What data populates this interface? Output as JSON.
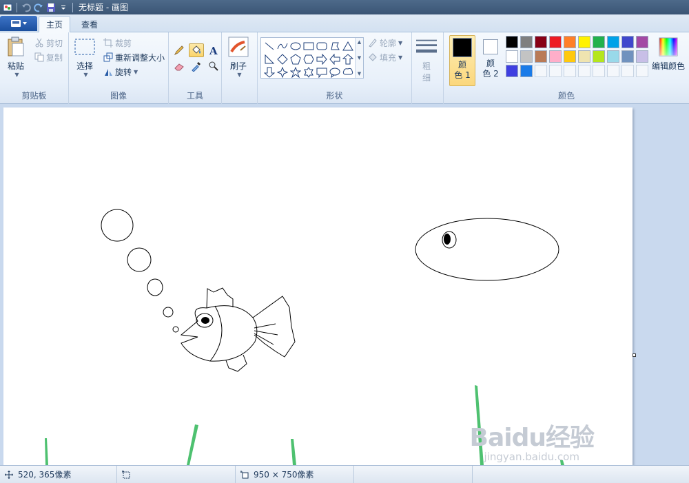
{
  "window": {
    "title": "无标题 - 画图"
  },
  "tabs": [
    {
      "label": "主页"
    },
    {
      "label": "查看"
    }
  ],
  "clipboard": {
    "paste_label": "粘贴",
    "cut_label": "剪切",
    "copy_label": "复制",
    "group_label": "剪贴板"
  },
  "image": {
    "select_label": "选择",
    "crop_label": "裁剪",
    "resize_label": "重新调整大小",
    "rotate_label": "旋转",
    "group_label": "图像"
  },
  "tools": {
    "group_label": "工具"
  },
  "brushes": {
    "label": "刷子"
  },
  "shapes": {
    "outline_label": "轮廓",
    "fill_label": "填充",
    "group_label": "形状"
  },
  "size": {
    "label_top": "粗",
    "label_bottom": "细"
  },
  "colors": {
    "color1_top": "颜",
    "color1_bottom": "色 1",
    "color2_top": "颜",
    "color2_bottom": "色 2",
    "edit_label": "编辑颜色",
    "group_label": "颜色",
    "color1_value": "#000000",
    "color2_value": "#ffffff",
    "palette": [
      "#000000",
      "#7f7f7f",
      "#880015",
      "#ed1c24",
      "#ff7f27",
      "#fff200",
      "#22b14c",
      "#00a2e8",
      "#3f48cc",
      "#a349a4",
      "#ffffff",
      "#c3c3c3",
      "#b97a57",
      "#ffaec9",
      "#ffc90e",
      "#efe4b0",
      "#b5e61d",
      "#99d9ea",
      "#7092be",
      "#c8bfe7",
      "#3f3fe0",
      "#1a7be8",
      "",
      "",
      "",
      "",
      "",
      "",
      "",
      ""
    ]
  },
  "status": {
    "cursor_pos": "520, 365像素",
    "selection_size": "",
    "canvas_size": "950 × 750像素"
  },
  "watermark": {
    "main": "Baidu经验",
    "sub": "jingyan.baidu.com"
  }
}
